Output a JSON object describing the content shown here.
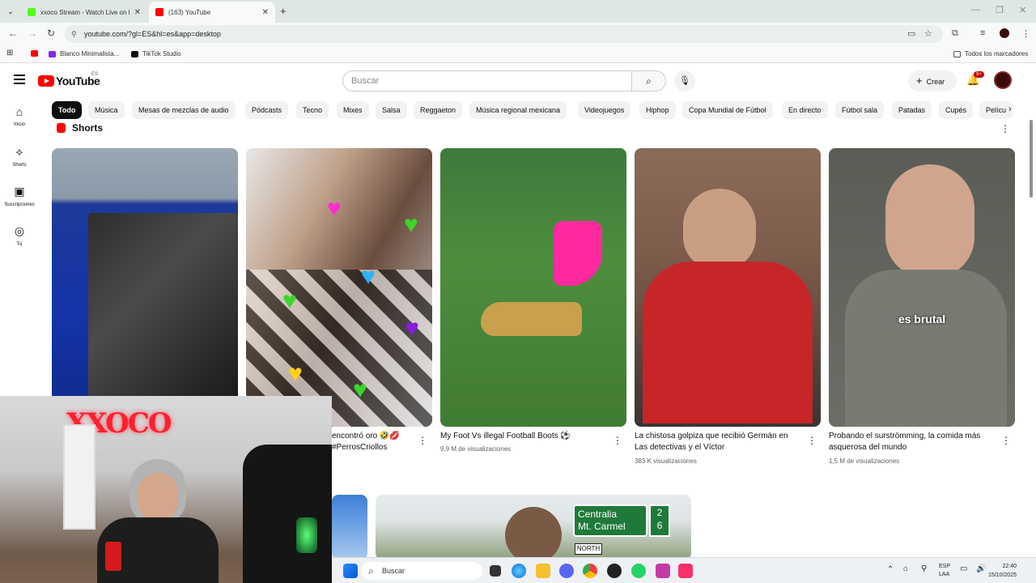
{
  "browser": {
    "tabs": [
      {
        "title": "xxoco Stream - Watch Live on K"
      },
      {
        "title": "(163) YouTube"
      }
    ],
    "url": "youtube.com/?gl=ES&hl=es&app=desktop",
    "bookmarks": [
      {
        "label": ""
      },
      {
        "label": "Blanco Minimalista..."
      },
      {
        "label": "TikTok Studio"
      }
    ],
    "all_bookmarks": "Todos los marcadores"
  },
  "youtube": {
    "logo_text": "YouTube",
    "country": "ES",
    "search_placeholder": "Buscar",
    "create_label": "Crear",
    "notif_badge": "9+",
    "sidebar": [
      {
        "label": "Inicio",
        "icon": "home-icon"
      },
      {
        "label": "Shorts",
        "icon": "shorts-icon"
      },
      {
        "label": "Suscripciones",
        "icon": "subscriptions-icon"
      },
      {
        "label": "Tú",
        "icon": "you-icon"
      }
    ],
    "chips": [
      "Todo",
      "Música",
      "Mesas de mezclas de audio",
      "Pódcasts",
      "Tecno",
      "Mixes",
      "Salsa",
      "Reggaeton",
      "Música regional mexicana",
      "Videojuegos",
      "Hiphop",
      "Copa Mundial de Fútbol",
      "En directo",
      "Fútbol sala",
      "Patadas",
      "Cupés",
      "Pelícu"
    ],
    "shorts_heading": "Shorts",
    "shorts": [
      {
        "title": "",
        "views": ""
      },
      {
        "title": "encontró oro 🤣💋 #PerrosCriollos",
        "views": ""
      },
      {
        "title": "My Foot Vs illegal Football Boots ⚽",
        "views": "9,9 M de visualizaciones"
      },
      {
        "title": "La chistosa golpiza que recibió Germán en Las detectivas y el Víctor",
        "views": "383 K visualizaciones"
      },
      {
        "title": "Probando el surströmming, la comida más asquerosa del mundo",
        "views": "1,5 M de visualizaciones",
        "caption": "es brutal"
      }
    ],
    "video_sign": {
      "line1": "Centralia",
      "line2": "Mt. Carmel",
      "num1": "2",
      "num2": "6",
      "north": "NORTH"
    }
  },
  "overlay": {
    "neon_text": "XXOCO"
  },
  "taskbar": {
    "search_placeholder": "Buscar",
    "lang1": "ESP",
    "lang2": "LAA",
    "time": "22:40",
    "date": "15/10/2025"
  },
  "colors": {
    "yt_red": "#ff0000",
    "chip_selected": "#0f0f0f",
    "chip_bg": "#f2f2f2"
  }
}
